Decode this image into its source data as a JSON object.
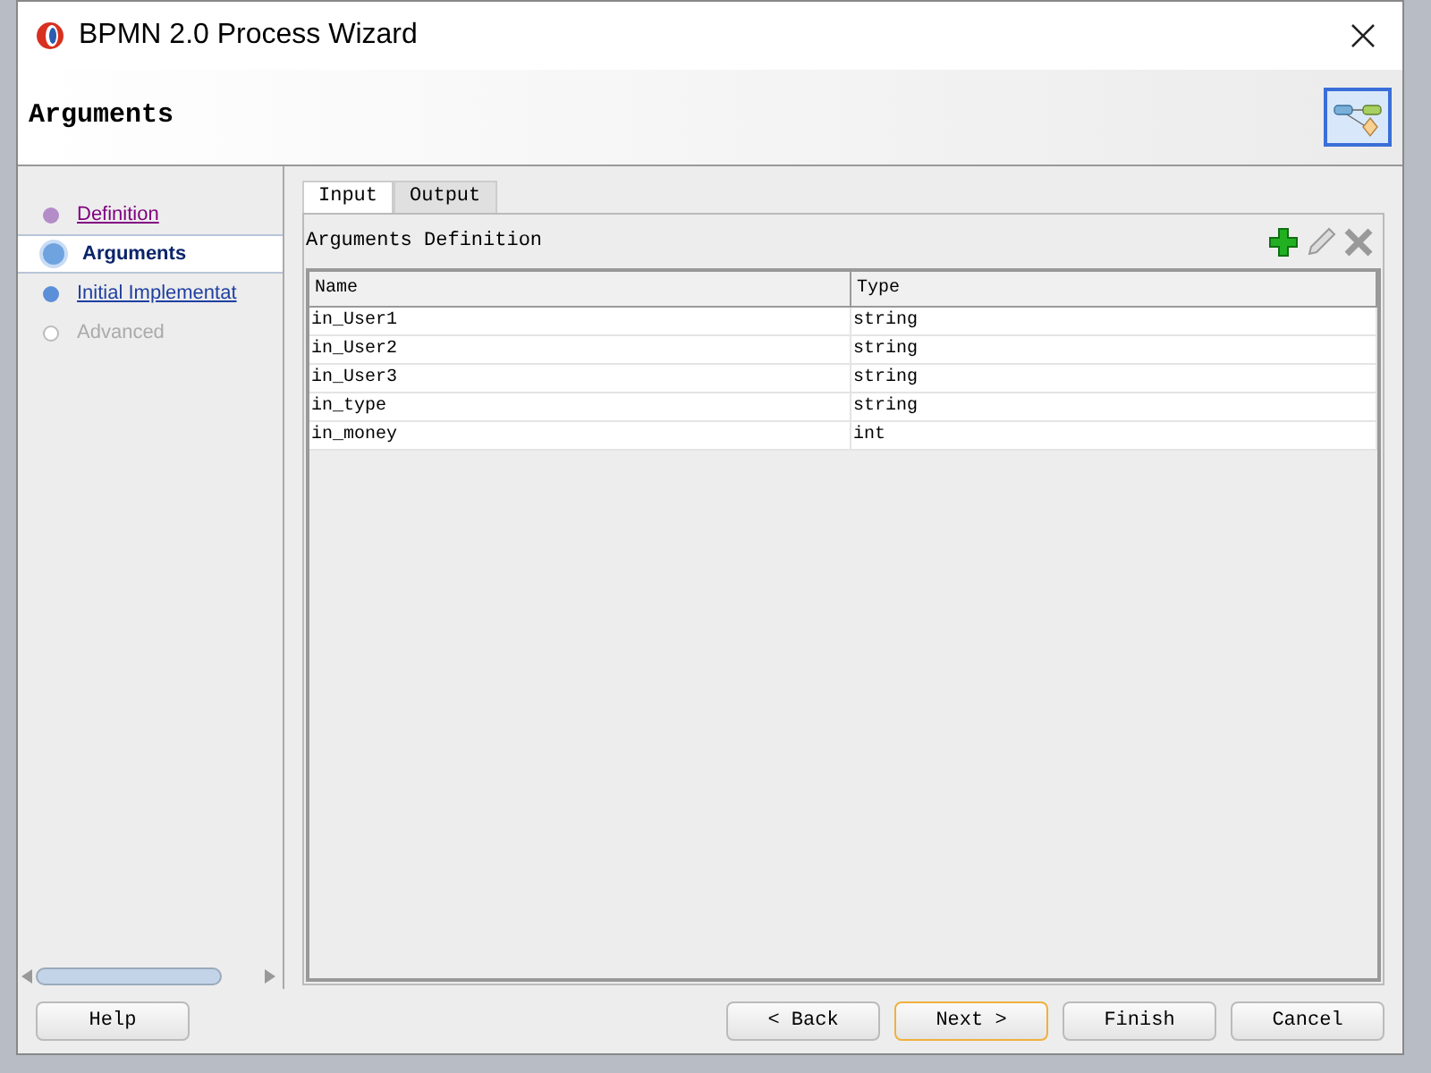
{
  "window": {
    "title": "BPMN 2.0 Process Wizard"
  },
  "header": {
    "title": "Arguments"
  },
  "steps": [
    {
      "label": "Definition",
      "kind": "visited",
      "selected": false
    },
    {
      "label": "Arguments",
      "kind": "current",
      "selected": true
    },
    {
      "label": "Initial Implementat",
      "kind": "link",
      "selected": false
    },
    {
      "label": "Advanced",
      "kind": "disabled",
      "selected": false
    }
  ],
  "tabs": [
    {
      "label": "Input",
      "selected": true
    },
    {
      "label": "Output",
      "selected": false
    }
  ],
  "section_title": "Arguments Definition",
  "table": {
    "columns": [
      "Name",
      "Type"
    ],
    "rows": [
      [
        "in_User1",
        "string"
      ],
      [
        "in_User2",
        "string"
      ],
      [
        "in_User3",
        "string"
      ],
      [
        "in_type",
        "string"
      ],
      [
        "in_money",
        "int"
      ]
    ]
  },
  "buttons": {
    "help": "Help",
    "back": "< Back",
    "next": "Next >",
    "finish": "Finish",
    "cancel": "Cancel"
  }
}
